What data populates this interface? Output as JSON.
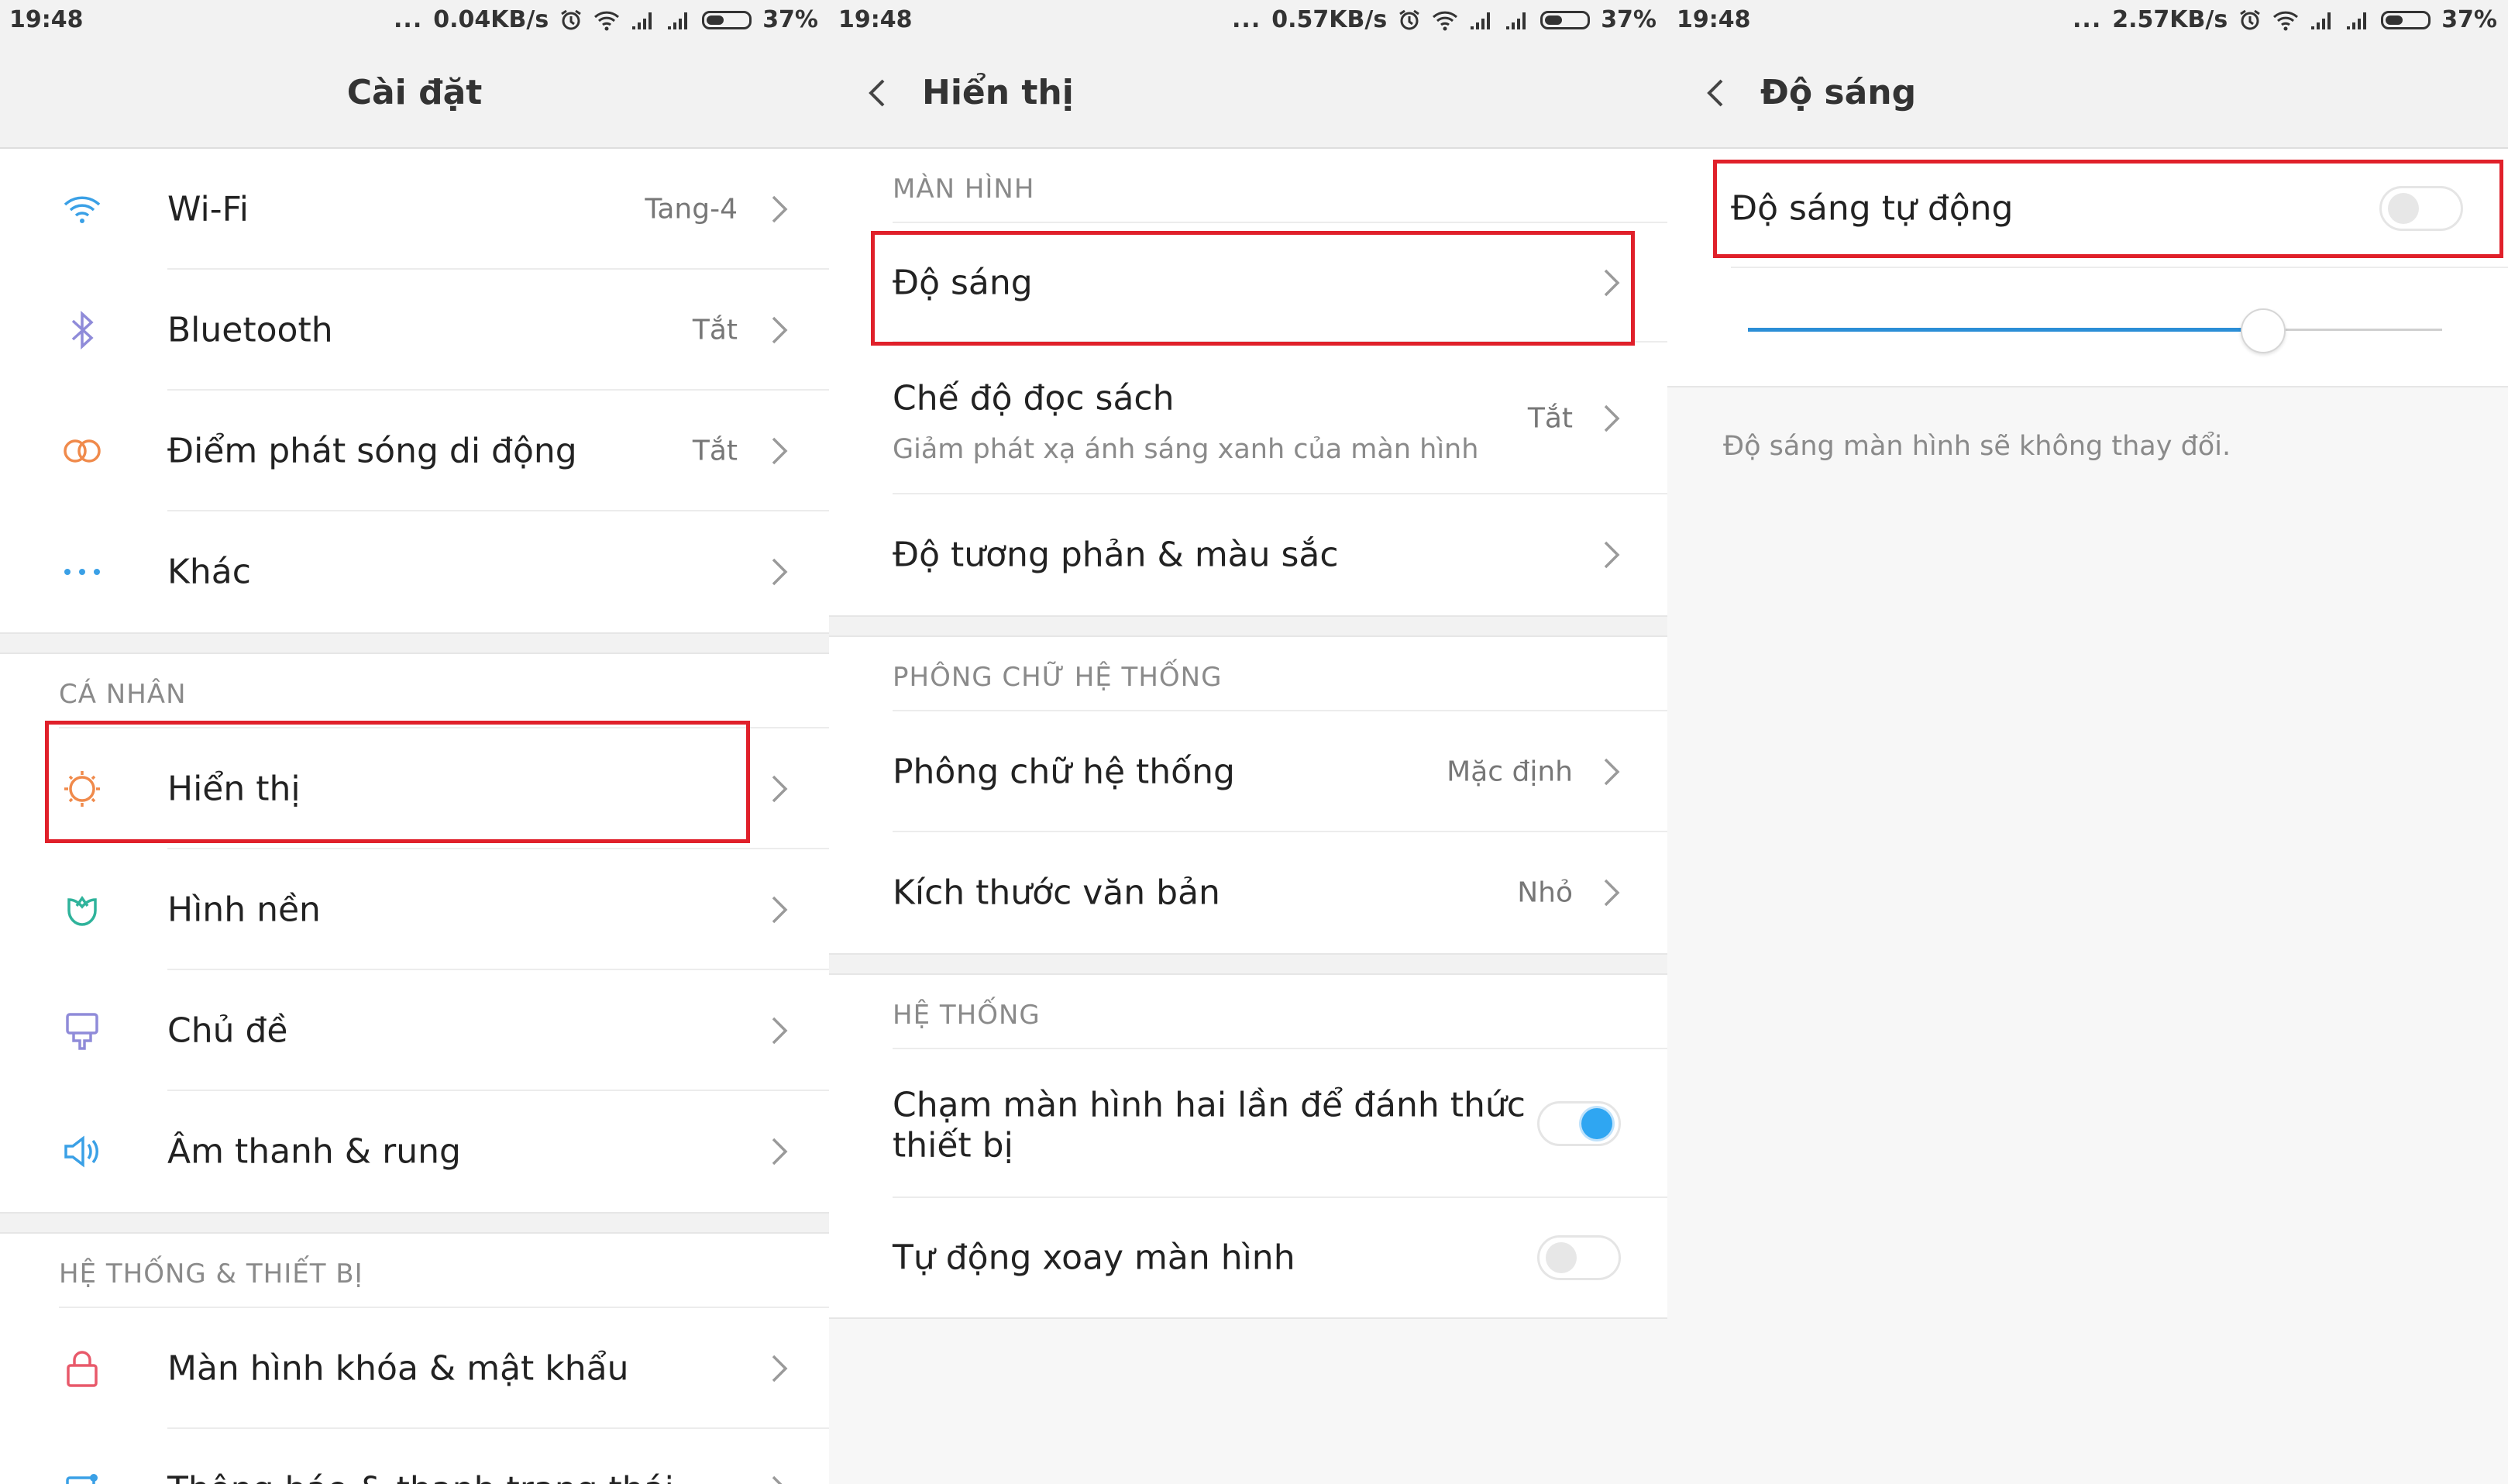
{
  "colors": {
    "highlight": "#e0202a",
    "toggle_on": "#2fa6f2",
    "slider": "#2b8ed6"
  },
  "panel1": {
    "status": {
      "time": "19:48",
      "dots": "...",
      "speed": "0.04KB/s",
      "battery": "37%"
    },
    "title": "Cài đặt",
    "items_top": [
      {
        "label": "Wi-Fi",
        "value": "Tang-4",
        "icon": "wifi-icon"
      },
      {
        "label": "Bluetooth",
        "value": "Tắt",
        "icon": "bluetooth-icon"
      },
      {
        "label": "Điểm phát sóng di động",
        "value": "Tắt",
        "icon": "hotspot-icon"
      },
      {
        "label": "Khác",
        "value": "",
        "icon": "more-icon"
      }
    ],
    "section_personal": "CÁ NHÂN",
    "items_personal": [
      {
        "label": "Hiển thị",
        "icon": "display-icon"
      },
      {
        "label": "Hình nền",
        "icon": "wallpaper-icon"
      },
      {
        "label": "Chủ đề",
        "icon": "theme-icon"
      },
      {
        "label": "Âm thanh & rung",
        "icon": "sound-icon"
      }
    ],
    "section_system": "HỆ THỐNG & THIẾT BỊ",
    "items_system": [
      {
        "label": "Màn hình khóa & mật khẩu",
        "icon": "lock-icon"
      },
      {
        "label": "Thông báo & thanh trạng thái",
        "icon": "notification-icon"
      }
    ]
  },
  "panel2": {
    "status": {
      "time": "19:48",
      "dots": "...",
      "speed": "0.57KB/s",
      "battery": "37%"
    },
    "title": "Hiển thị",
    "section_screen": "MÀN HÌNH",
    "brightness": "Độ sáng",
    "reading_mode": {
      "label": "Chế độ đọc sách",
      "sub": "Giảm phát xạ ánh sáng xanh của màn hình",
      "value": "Tắt"
    },
    "contrast": "Độ tương phản & màu sắc",
    "section_font": "PHÔNG CHỮ HỆ THỐNG",
    "font": {
      "label": "Phông chữ hệ thống",
      "value": "Mặc định"
    },
    "text_size": {
      "label": "Kích thước văn bản",
      "value": "Nhỏ"
    },
    "section_system": "HỆ THỐNG",
    "double_tap": {
      "label_line1": "Chạm màn hình hai lần để đánh thức",
      "label_line2": "thiết bị",
      "on": true
    },
    "auto_rotate": {
      "label": "Tự động xoay màn hình",
      "on": false
    }
  },
  "panel3": {
    "status": {
      "time": "19:48",
      "dots": "...",
      "speed": "2.57KB/s",
      "battery": "37%"
    },
    "title": "Độ sáng",
    "auto_brightness": {
      "label": "Độ sáng tự động",
      "on": false
    },
    "slider_level": 0.74,
    "note": "Độ sáng màn hình sẽ không thay đổi."
  }
}
